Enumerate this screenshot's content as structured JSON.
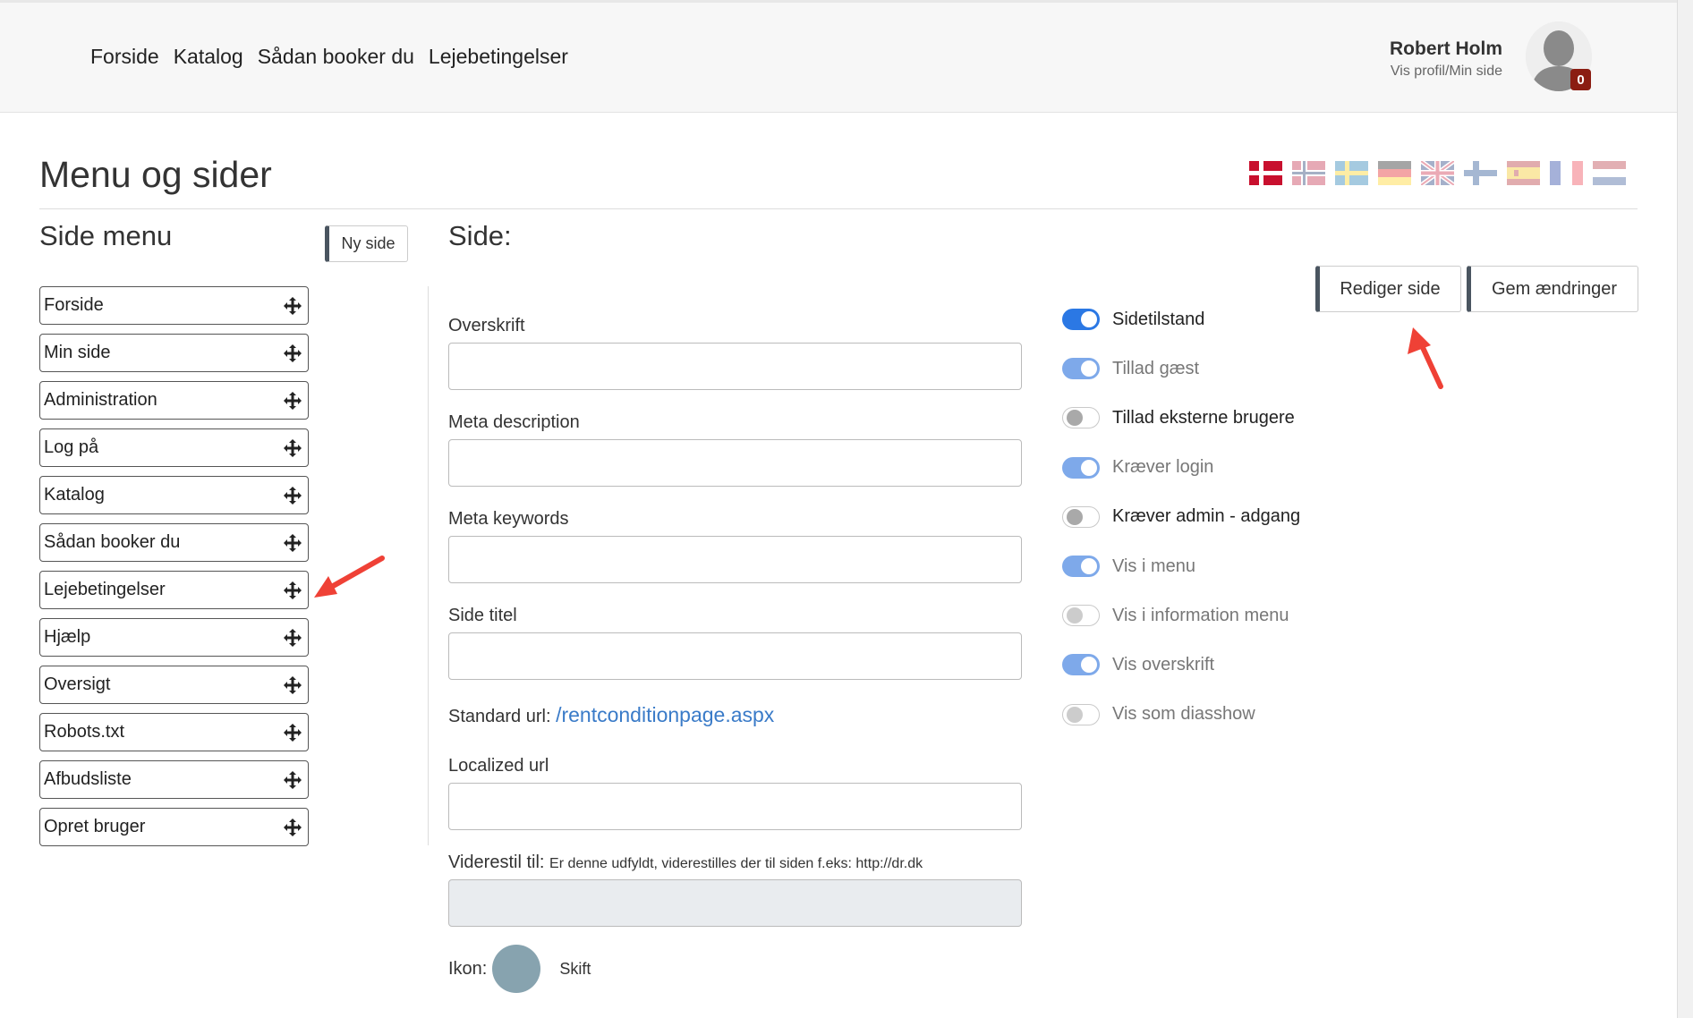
{
  "header": {
    "nav": [
      "Forside",
      "Katalog",
      "Sådan booker du",
      "Lejebetingelser"
    ],
    "user_name": "Robert Holm",
    "user_link": "Vis profil/Min side",
    "badge_count": "0"
  },
  "page": {
    "title": "Menu og sider",
    "flags": [
      "dk",
      "no",
      "se",
      "de",
      "gb",
      "fi",
      "es",
      "fr",
      "nl"
    ]
  },
  "side_menu": {
    "title": "Side menu",
    "new_button": "Ny side",
    "items": [
      "Forside",
      "Min side",
      "Administration",
      "Log på",
      "Katalog",
      "Sådan booker du",
      "Lejebetingelser",
      "Hjælp",
      "Oversigt",
      "Robots.txt",
      "Afbudsliste",
      "Opret bruger"
    ]
  },
  "side": {
    "title": "Side:",
    "edit_button": "Rediger side",
    "save_button": "Gem ændringer",
    "fields": {
      "overskrift": "Overskrift",
      "meta_description": "Meta description",
      "meta_keywords": "Meta keywords",
      "side_titel": "Side titel",
      "localized_url": "Localized url"
    },
    "standard_url_label": "Standard url:",
    "standard_url_value": "/rentconditionpage.aspx",
    "redirect_label": "Viderestil til:",
    "redirect_hint": "Er denne udfyldt, viderestilles der til siden f.eks: http://dr.dk",
    "icon_label": "Ikon:",
    "icon_change": "Skift",
    "toggles": [
      {
        "label": "Sidetilstand",
        "state": "on",
        "muted": false
      },
      {
        "label": "Tillad gæst",
        "state": "on",
        "muted": true
      },
      {
        "label": "Tillad eksterne brugere",
        "state": "off",
        "muted": false
      },
      {
        "label": "Kræver login",
        "state": "on",
        "muted": true
      },
      {
        "label": "Kræver admin - adgang",
        "state": "off",
        "muted": false
      },
      {
        "label": "Vis i menu",
        "state": "on",
        "muted": true
      },
      {
        "label": "Vis i information menu",
        "state": "off",
        "muted": true
      },
      {
        "label": "Vis overskrift",
        "state": "on",
        "muted": true
      },
      {
        "label": "Vis som diasshow",
        "state": "off",
        "muted": true
      }
    ]
  },
  "colors": {
    "accent": "#2b78e4",
    "link": "#3a7bc8",
    "badge": "#8b1d12",
    "annotation_arrow": "#ef4136"
  }
}
